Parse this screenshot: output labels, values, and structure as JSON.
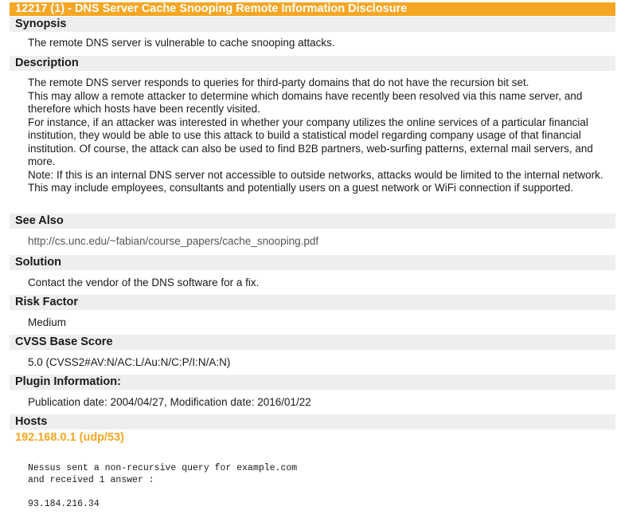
{
  "title": "12217 (1) - DNS Server Cache Snooping Remote Information Disclosure",
  "synopsis": {
    "heading": "Synopsis",
    "text": "The remote DNS server is vulnerable to cache snooping attacks."
  },
  "description": {
    "heading": "Description",
    "paragraphs": [
      "The remote DNS server responds to queries for third-party domains that do not have the recursion bit set.",
      "This may allow a remote attacker to determine which domains have recently been resolved via this name server, and therefore which hosts have been recently visited.",
      "For instance, if an attacker was interested in whether your company utilizes the online services of a particular financial institution, they would be able to use this attack to build a statistical model regarding company usage of that financial institution. Of course, the attack can also be used to find B2B partners, web-surfing patterns, external mail servers, and more.",
      "Note: If this is an internal DNS server not accessible to outside networks, attacks would be limited to the internal network. This may include employees, consultants and potentially users on a guest network or WiFi connection if supported."
    ]
  },
  "see_also": {
    "heading": "See Also",
    "link": "http://cs.unc.edu/~fabian/course_papers/cache_snooping.pdf"
  },
  "solution": {
    "heading": "Solution",
    "text": "Contact the vendor of the DNS software for a fix."
  },
  "risk_factor": {
    "heading": "Risk Factor",
    "text": "Medium"
  },
  "cvss": {
    "heading": "CVSS Base Score",
    "text": "5.0 (CVSS2#AV:N/AC:L/Au:N/C:P/I:N/A:N)"
  },
  "plugin_info": {
    "heading": "Plugin Information:",
    "text": "Publication date: 2004/04/27, Modification date: 2016/01/22"
  },
  "hosts": {
    "heading": "Hosts",
    "host": "192.168.0.1 (udp/53)",
    "output_line1": "Nessus sent a non-recursive query for example.com",
    "output_line2": "and received 1 answer :",
    "output_line3": "93.184.216.34"
  }
}
